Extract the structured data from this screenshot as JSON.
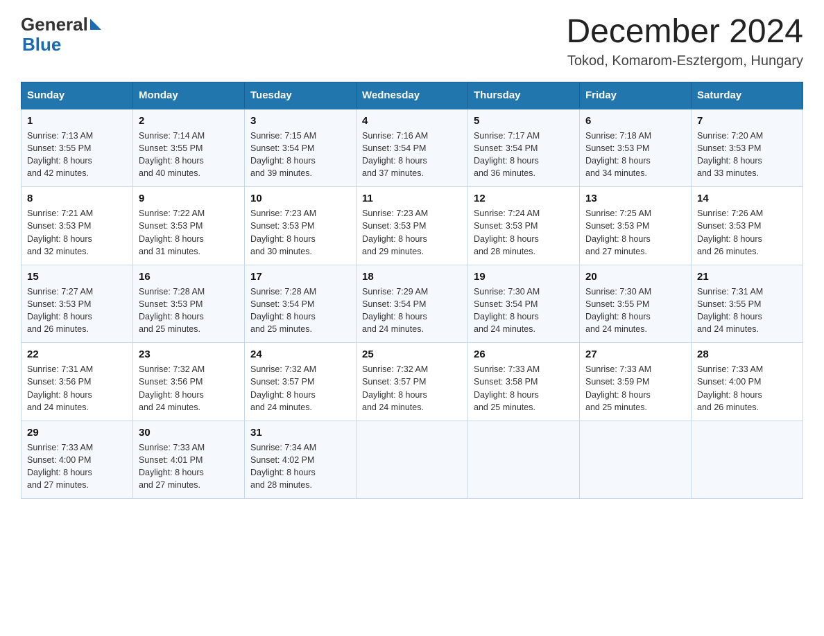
{
  "header": {
    "logo_general": "General",
    "logo_blue": "Blue",
    "title": "December 2024",
    "subtitle": "Tokod, Komarom-Esztergom, Hungary"
  },
  "days_of_week": [
    "Sunday",
    "Monday",
    "Tuesday",
    "Wednesday",
    "Thursday",
    "Friday",
    "Saturday"
  ],
  "weeks": [
    [
      {
        "day": "1",
        "sunrise": "7:13 AM",
        "sunset": "3:55 PM",
        "daylight": "8 hours and 42 minutes."
      },
      {
        "day": "2",
        "sunrise": "7:14 AM",
        "sunset": "3:55 PM",
        "daylight": "8 hours and 40 minutes."
      },
      {
        "day": "3",
        "sunrise": "7:15 AM",
        "sunset": "3:54 PM",
        "daylight": "8 hours and 39 minutes."
      },
      {
        "day": "4",
        "sunrise": "7:16 AM",
        "sunset": "3:54 PM",
        "daylight": "8 hours and 37 minutes."
      },
      {
        "day": "5",
        "sunrise": "7:17 AM",
        "sunset": "3:54 PM",
        "daylight": "8 hours and 36 minutes."
      },
      {
        "day": "6",
        "sunrise": "7:18 AM",
        "sunset": "3:53 PM",
        "daylight": "8 hours and 34 minutes."
      },
      {
        "day": "7",
        "sunrise": "7:20 AM",
        "sunset": "3:53 PM",
        "daylight": "8 hours and 33 minutes."
      }
    ],
    [
      {
        "day": "8",
        "sunrise": "7:21 AM",
        "sunset": "3:53 PM",
        "daylight": "8 hours and 32 minutes."
      },
      {
        "day": "9",
        "sunrise": "7:22 AM",
        "sunset": "3:53 PM",
        "daylight": "8 hours and 31 minutes."
      },
      {
        "day": "10",
        "sunrise": "7:23 AM",
        "sunset": "3:53 PM",
        "daylight": "8 hours and 30 minutes."
      },
      {
        "day": "11",
        "sunrise": "7:23 AM",
        "sunset": "3:53 PM",
        "daylight": "8 hours and 29 minutes."
      },
      {
        "day": "12",
        "sunrise": "7:24 AM",
        "sunset": "3:53 PM",
        "daylight": "8 hours and 28 minutes."
      },
      {
        "day": "13",
        "sunrise": "7:25 AM",
        "sunset": "3:53 PM",
        "daylight": "8 hours and 27 minutes."
      },
      {
        "day": "14",
        "sunrise": "7:26 AM",
        "sunset": "3:53 PM",
        "daylight": "8 hours and 26 minutes."
      }
    ],
    [
      {
        "day": "15",
        "sunrise": "7:27 AM",
        "sunset": "3:53 PM",
        "daylight": "8 hours and 26 minutes."
      },
      {
        "day": "16",
        "sunrise": "7:28 AM",
        "sunset": "3:53 PM",
        "daylight": "8 hours and 25 minutes."
      },
      {
        "day": "17",
        "sunrise": "7:28 AM",
        "sunset": "3:54 PM",
        "daylight": "8 hours and 25 minutes."
      },
      {
        "day": "18",
        "sunrise": "7:29 AM",
        "sunset": "3:54 PM",
        "daylight": "8 hours and 24 minutes."
      },
      {
        "day": "19",
        "sunrise": "7:30 AM",
        "sunset": "3:54 PM",
        "daylight": "8 hours and 24 minutes."
      },
      {
        "day": "20",
        "sunrise": "7:30 AM",
        "sunset": "3:55 PM",
        "daylight": "8 hours and 24 minutes."
      },
      {
        "day": "21",
        "sunrise": "7:31 AM",
        "sunset": "3:55 PM",
        "daylight": "8 hours and 24 minutes."
      }
    ],
    [
      {
        "day": "22",
        "sunrise": "7:31 AM",
        "sunset": "3:56 PM",
        "daylight": "8 hours and 24 minutes."
      },
      {
        "day": "23",
        "sunrise": "7:32 AM",
        "sunset": "3:56 PM",
        "daylight": "8 hours and 24 minutes."
      },
      {
        "day": "24",
        "sunrise": "7:32 AM",
        "sunset": "3:57 PM",
        "daylight": "8 hours and 24 minutes."
      },
      {
        "day": "25",
        "sunrise": "7:32 AM",
        "sunset": "3:57 PM",
        "daylight": "8 hours and 24 minutes."
      },
      {
        "day": "26",
        "sunrise": "7:33 AM",
        "sunset": "3:58 PM",
        "daylight": "8 hours and 25 minutes."
      },
      {
        "day": "27",
        "sunrise": "7:33 AM",
        "sunset": "3:59 PM",
        "daylight": "8 hours and 25 minutes."
      },
      {
        "day": "28",
        "sunrise": "7:33 AM",
        "sunset": "4:00 PM",
        "daylight": "8 hours and 26 minutes."
      }
    ],
    [
      {
        "day": "29",
        "sunrise": "7:33 AM",
        "sunset": "4:00 PM",
        "daylight": "8 hours and 27 minutes."
      },
      {
        "day": "30",
        "sunrise": "7:33 AM",
        "sunset": "4:01 PM",
        "daylight": "8 hours and 27 minutes."
      },
      {
        "day": "31",
        "sunrise": "7:34 AM",
        "sunset": "4:02 PM",
        "daylight": "8 hours and 28 minutes."
      },
      null,
      null,
      null,
      null
    ]
  ],
  "labels": {
    "sunrise": "Sunrise: ",
    "sunset": "Sunset: ",
    "daylight": "Daylight: "
  }
}
